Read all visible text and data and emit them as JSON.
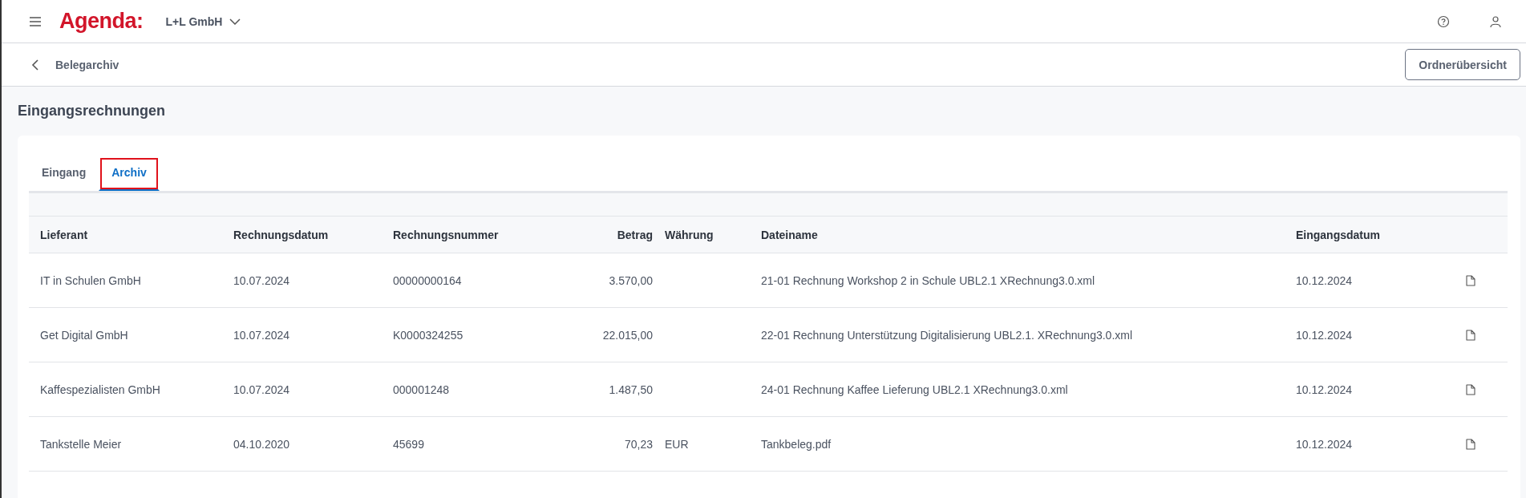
{
  "header": {
    "logo": "Agenda:",
    "company": "L+L GmbH"
  },
  "subheader": {
    "title": "Belegarchiv",
    "button": "Ordnerübersicht"
  },
  "page_title": "Eingangsrechnungen",
  "tabs": [
    {
      "label": "Eingang",
      "selected": false,
      "highlighted": false
    },
    {
      "label": "Archiv",
      "selected": true,
      "highlighted": true
    }
  ],
  "table": {
    "columns": [
      "Lieferant",
      "Rechnungsdatum",
      "Rechnungsnummer",
      "Betrag",
      "Währung",
      "Dateiname",
      "Eingangsdatum"
    ],
    "rows": [
      {
        "cells": [
          "IT in Schulen GmbH",
          "10.07.2024",
          "00000000164",
          "3.570,00",
          "",
          "21-01 Rechnung Workshop 2 in Schule UBL2.1 XRechnung3.0.xml",
          "10.12.2024"
        ]
      },
      {
        "cells": [
          "Get Digital GmbH",
          "10.07.2024",
          "K0000324255",
          "22.015,00",
          "",
          "22-01 Rechnung Unterstützung Digitalisierung UBL2.1. XRechnung3.0.xml",
          "10.12.2024"
        ]
      },
      {
        "cells": [
          "Kaffespezialisten GmbH",
          "10.07.2024",
          "000001248",
          "1.487,50",
          "",
          "24-01 Rechnung Kaffee Lieferung UBL2.1 XRechnung3.0.xml",
          "10.12.2024"
        ]
      },
      {
        "cells": [
          "Tankstelle Meier",
          "04.10.2020",
          "45699",
          "70,23",
          "EUR",
          "Tankbeleg.pdf",
          "10.12.2024"
        ]
      }
    ]
  }
}
